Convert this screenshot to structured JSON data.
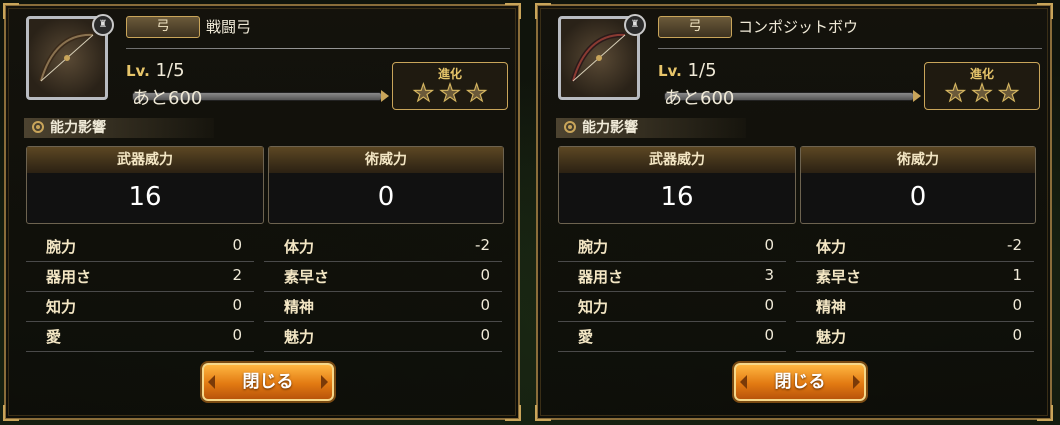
{
  "panels": [
    {
      "type_label": "弓",
      "name": "戦闘弓",
      "lv_label": "Lv.",
      "level": "1/5",
      "exp_remaining": "あと600",
      "evolution_label": "進化",
      "evolution_stars": 3,
      "section_title": "能力影響",
      "weapon_power_label": "武器威力",
      "weapon_power": "16",
      "magic_power_label": "術威力",
      "magic_power": "0",
      "stats_left": [
        {
          "name": "腕力",
          "value": "0"
        },
        {
          "name": "器用さ",
          "value": "2"
        },
        {
          "name": "知力",
          "value": "0"
        },
        {
          "name": "愛",
          "value": "0"
        }
      ],
      "stats_right": [
        {
          "name": "体力",
          "value": "-2"
        },
        {
          "name": "素早さ",
          "value": "0"
        },
        {
          "name": "精神",
          "value": "0"
        },
        {
          "name": "魅力",
          "value": "0"
        }
      ],
      "close_label": "閉じる"
    },
    {
      "type_label": "弓",
      "name": "コンポジットボウ",
      "lv_label": "Lv.",
      "level": "1/5",
      "exp_remaining": "あと600",
      "evolution_label": "進化",
      "evolution_stars": 3,
      "section_title": "能力影響",
      "weapon_power_label": "武器威力",
      "weapon_power": "16",
      "magic_power_label": "術威力",
      "magic_power": "0",
      "stats_left": [
        {
          "name": "腕力",
          "value": "0"
        },
        {
          "name": "器用さ",
          "value": "3"
        },
        {
          "name": "知力",
          "value": "0"
        },
        {
          "name": "愛",
          "value": "0"
        }
      ],
      "stats_right": [
        {
          "name": "体力",
          "value": "-2"
        },
        {
          "name": "素早さ",
          "value": "1"
        },
        {
          "name": "精神",
          "value": "0"
        },
        {
          "name": "魅力",
          "value": "0"
        }
      ],
      "close_label": "閉じる"
    }
  ],
  "icons": [
    "bow-icon",
    "star-icon",
    "gear-icon",
    "rank-badge-icon"
  ],
  "colors": {
    "accent_gold": "#c9a55a",
    "button_orange": "#e27a12",
    "panel_border": "#8a6d3a"
  }
}
